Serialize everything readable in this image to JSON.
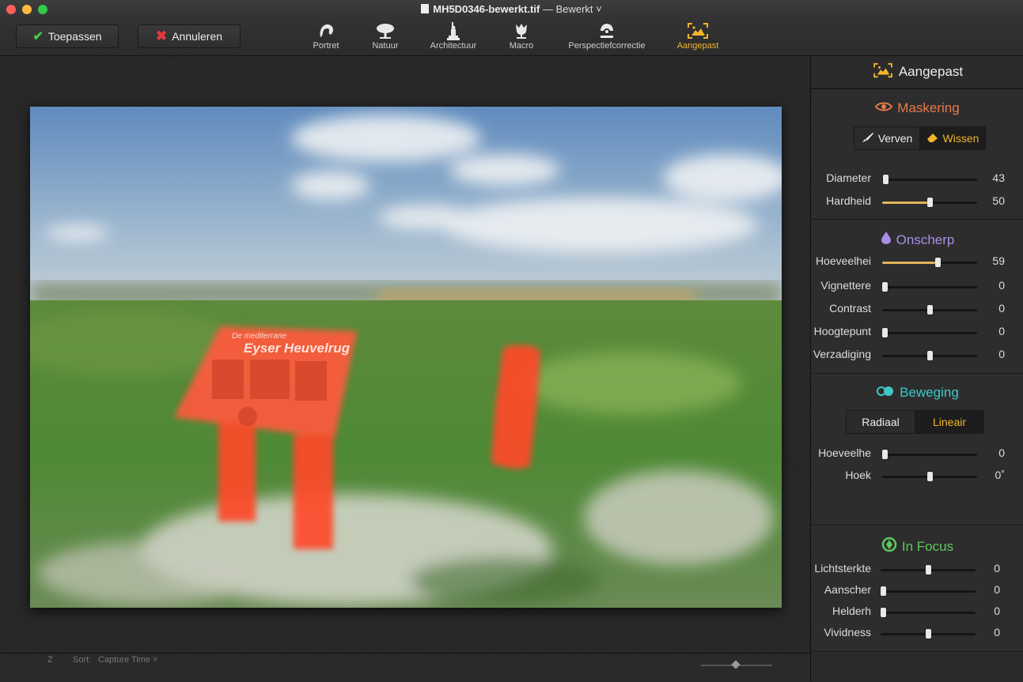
{
  "window": {
    "title_file": "MH5D0346-bewerkt.tif",
    "title_suffix": "— Bewerkt ˅"
  },
  "toolbar": {
    "apply_label": "Toepassen",
    "cancel_label": "Annuleren",
    "tools": [
      {
        "label": "Portret",
        "icon": "portrait-icon"
      },
      {
        "label": "Natuur",
        "icon": "tree-icon"
      },
      {
        "label": "Architectuur",
        "icon": "statue-icon"
      },
      {
        "label": "Macro",
        "icon": "flower-icon"
      },
      {
        "label": "Perspectiefcorrectie",
        "icon": "perspective-icon"
      },
      {
        "label": "Aangepast",
        "icon": "custom-icon",
        "active": true
      }
    ]
  },
  "bottombar": {
    "sort_label": "Sort:",
    "sort_value": "Capture Time ˅"
  },
  "sidebar": {
    "header": "Aangepast",
    "masking": {
      "title": "Maskering",
      "paint_label": "Verven",
      "erase_label": "Wissen",
      "active_tool": "Wissen",
      "sliders": [
        {
          "label": "Diameter",
          "value": "43",
          "pos": 0.03,
          "fill": false
        },
        {
          "label": "Hardheid",
          "value": "50",
          "pos": 0.5,
          "fill": true
        }
      ]
    },
    "blur": {
      "title": "Onscherp",
      "sliders": [
        {
          "label": "Hoeveelhei",
          "value": "59",
          "pos": 0.58,
          "fill": true
        },
        {
          "label": "Vignettere",
          "value": "0",
          "pos": 0.0,
          "fill": false
        },
        {
          "label": "Contrast",
          "value": "0",
          "pos": 0.5,
          "fill": false
        },
        {
          "label": "Hoogtepunt",
          "value": "0",
          "pos": 0.0,
          "fill": false
        },
        {
          "label": "Verzadiging",
          "value": "0",
          "pos": 0.5,
          "fill": false
        }
      ]
    },
    "motion": {
      "title": "Beweging",
      "radial_label": "Radiaal",
      "linear_label": "Lineair",
      "active_mode": "Lineair",
      "sliders": [
        {
          "label": "Hoeveelhe",
          "value": "0",
          "pos": 0.0,
          "fill": false
        },
        {
          "label": "Hoek",
          "value": "0˚",
          "pos": 0.5,
          "fill": false
        }
      ]
    },
    "focus": {
      "title": "In Focus",
      "sliders": [
        {
          "label": "Lichtsterkte",
          "value": "0",
          "pos": 0.5,
          "fill": false
        },
        {
          "label": "Aanscher",
          "value": "0",
          "pos": 0.0,
          "fill": false
        },
        {
          "label": "Helderh",
          "value": "0",
          "pos": 0.0,
          "fill": false
        },
        {
          "label": "Vividness",
          "value": "0",
          "pos": 0.5,
          "fill": false
        }
      ]
    }
  },
  "photo": {
    "sign_title_small": "De mediterrane",
    "sign_title_large": "Eyser Heuvelrug"
  },
  "colors": {
    "accent": "#f2b42c",
    "masking": "#e87a4a",
    "blur": "#a98ee6",
    "motion": "#3ec8c8",
    "focus": "#5ec85e",
    "mask_overlay": "#ff3c28"
  }
}
